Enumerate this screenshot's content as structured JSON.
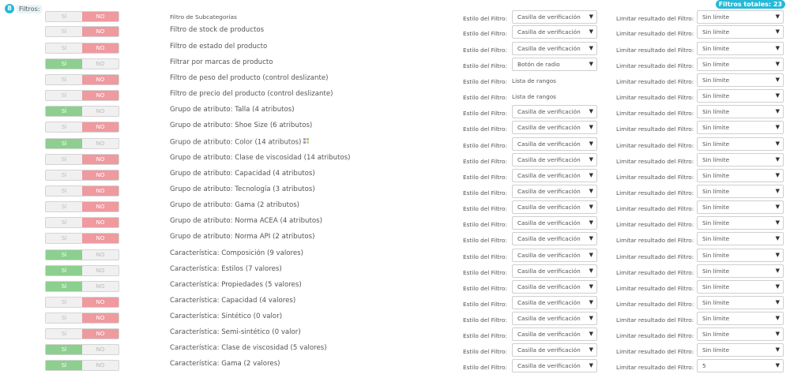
{
  "header": {
    "help_badge": "8",
    "filters_label": "Filtros:",
    "total_badge": "Filtros totales: 23"
  },
  "labels": {
    "yes": "SÍ",
    "no": "NO",
    "style": "Estilo del Filtro:",
    "limit": "Limitar resultado del Filtro:"
  },
  "filters": [
    {
      "name": "Filtro de Subcategorías",
      "enabled": false,
      "style": "Casilla de verificación",
      "style_type": "select",
      "limit": "Sin límite",
      "small": true
    },
    {
      "name": "Filtro de stock de productos",
      "enabled": false,
      "style": "Casilla de verificación",
      "style_type": "select",
      "limit": "Sin límite"
    },
    {
      "name": "Filtro de estado del producto",
      "enabled": false,
      "style": "Casilla de verificación",
      "style_type": "select",
      "limit": "Sin límite"
    },
    {
      "name": "Filtrar por marcas de producto",
      "enabled": true,
      "style": "Botón de radio",
      "style_type": "select",
      "limit": "Sin límite"
    },
    {
      "name": "Filtro de peso del producto (control deslizante)",
      "enabled": false,
      "style": "Lista de rangos",
      "style_type": "static",
      "limit": "Sin límite"
    },
    {
      "name": "Filtro de precio del producto (control deslizante)",
      "enabled": false,
      "style": "Lista de rangos",
      "style_type": "static",
      "limit": "Sin límite"
    },
    {
      "name": "Grupo de atributo: Talla (4 atributos)",
      "enabled": true,
      "style": "Casilla de verificación",
      "style_type": "select",
      "limit": "Sin límite"
    },
    {
      "name": "Grupo de atributo: Shoe Size (6 atributos)",
      "enabled": false,
      "style": "Casilla de verificación",
      "style_type": "select",
      "limit": "Sin límite"
    },
    {
      "name": "Grupo de atributo: Color (14 atributos)",
      "enabled": true,
      "style": "Casilla de verificación",
      "style_type": "select",
      "limit": "Sin límite",
      "icon": "color-swatch-icon"
    },
    {
      "name": "Grupo de atributo: Clase de viscosidad (14 atributos)",
      "enabled": false,
      "style": "Casilla de verificación",
      "style_type": "select",
      "limit": "Sin límite"
    },
    {
      "name": "Grupo de atributo: Capacidad (4 atributos)",
      "enabled": false,
      "style": "Casilla de verificación",
      "style_type": "select",
      "limit": "Sin límite"
    },
    {
      "name": "Grupo de atributo: Tecnología (3 atributos)",
      "enabled": false,
      "style": "Casilla de verificación",
      "style_type": "select",
      "limit": "Sin límite"
    },
    {
      "name": "Grupo de atributo: Gama (2 atributos)",
      "enabled": false,
      "style": "Casilla de verificación",
      "style_type": "select",
      "limit": "Sin límite"
    },
    {
      "name": "Grupo de atributo: Norma ACEA (4 atributos)",
      "enabled": false,
      "style": "Casilla de verificación",
      "style_type": "select",
      "limit": "Sin límite"
    },
    {
      "name": "Grupo de atributo: Norma API (2 atributos)",
      "enabled": false,
      "style": "Casilla de verificación",
      "style_type": "select",
      "limit": "Sin límite"
    },
    {
      "name": "Característica: Composición (9 valores)",
      "enabled": true,
      "style": "Casilla de verificación",
      "style_type": "select",
      "limit": "Sin límite"
    },
    {
      "name": "Característica: Estilos (7 valores)",
      "enabled": true,
      "style": "Casilla de verificación",
      "style_type": "select",
      "limit": "Sin límite"
    },
    {
      "name": "Característica: Propiedades (5 valores)",
      "enabled": true,
      "style": "Casilla de verificación",
      "style_type": "select",
      "limit": "Sin límite"
    },
    {
      "name": "Característica: Capacidad (4 valores)",
      "enabled": false,
      "style": "Casilla de verificación",
      "style_type": "select",
      "limit": "Sin límite"
    },
    {
      "name": "Característica: Sintético (0 valor)",
      "enabled": false,
      "style": "Casilla de verificación",
      "style_type": "select",
      "limit": "Sin límite"
    },
    {
      "name": "Característica: Semi-sintético (0 valor)",
      "enabled": false,
      "style": "Casilla de verificación",
      "style_type": "select",
      "limit": "Sin límite"
    },
    {
      "name": "Característica: Clase de viscosidad (5 valores)",
      "enabled": true,
      "style": "Casilla de verificación",
      "style_type": "select",
      "limit": "Sin límite"
    },
    {
      "name": "Característica: Gama (2 valores)",
      "enabled": true,
      "style": "Casilla de verificación",
      "style_type": "select",
      "limit": "5"
    }
  ],
  "colors": {
    "accent": "#25b9d7",
    "yes_active": "#8ccf8f",
    "no_active": "#ee9a9f"
  }
}
